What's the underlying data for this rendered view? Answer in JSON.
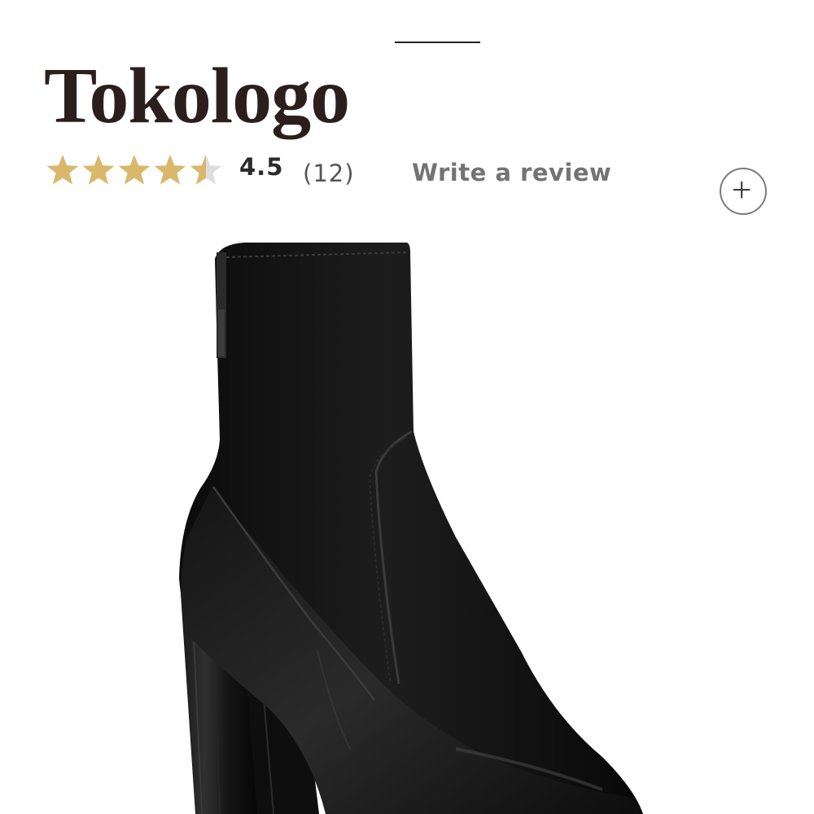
{
  "product": {
    "name": "Tokologo"
  },
  "rating": {
    "value": "4.5",
    "score": 4.5,
    "max_stars": 5,
    "count_text": "(12)",
    "star_color": "#d9b86c",
    "empty_star_color": "#dedede"
  },
  "actions": {
    "write_review_label": "Write a review"
  },
  "icons": {
    "expand": "plus-circle-icon"
  },
  "image": {
    "subject": "black-heeled-ankle-boot"
  }
}
